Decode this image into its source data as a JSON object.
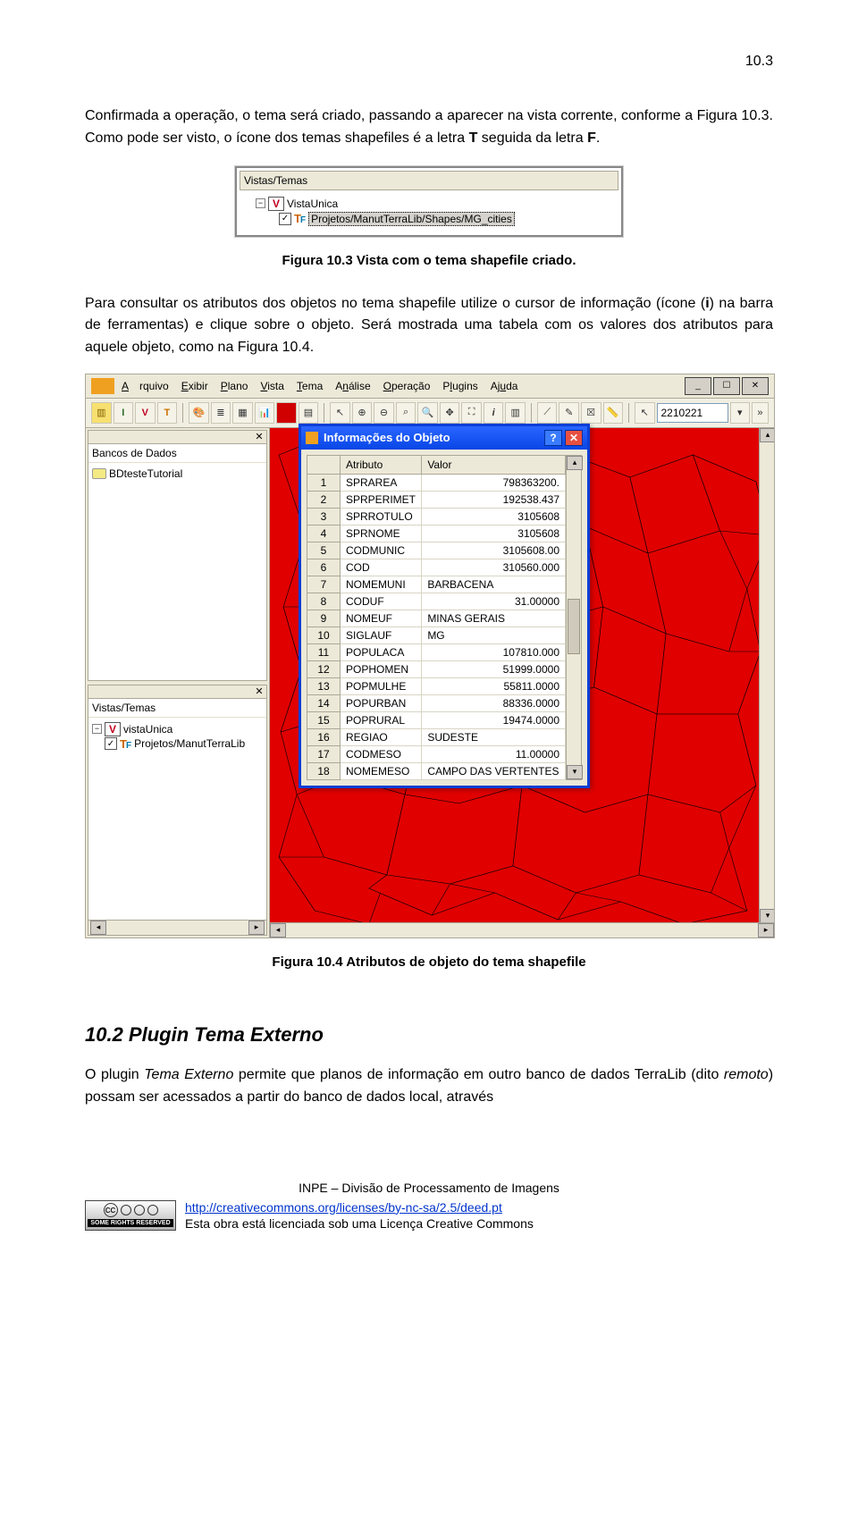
{
  "page_number": "10.3",
  "para1_a": "Confirmada a operação, o tema será criado, passando a aparecer na vista corrente, conforme a Figura 10.3. Como pode ser visto, o ícone dos temas shapefiles é a letra ",
  "para1_t": "T",
  "para1_b": " seguida da letra ",
  "para1_f": "F",
  "para1_c": ".",
  "fig103": {
    "panel_title": "Vistas/Temas",
    "view_name": "VistaUnica",
    "theme_path": "Projetos/ManutTerraLib/Shapes/MG_cities"
  },
  "caption103": "Figura 10.3 Vista com o tema shapefile criado.",
  "para2_a": "Para consultar os atributos dos objetos no tema shapefile utilize o cursor de informação (ícone (",
  "para2_i": "i",
  "para2_b": ") na barra de ferramentas) e clique sobre o objeto. Será mostrada uma tabela com os valores dos atributos para aquele objeto, como na Figura 10.4.",
  "fig104": {
    "menu": [
      "Arquivo",
      "Exibir",
      "Plano",
      "Vista",
      "Tema",
      "Análise",
      "Operação",
      "Plugins",
      "Ajuda"
    ],
    "toolbar_value": "2210221",
    "db_panel": {
      "title": "Bancos de Dados",
      "item": "BDtesteTutorial"
    },
    "vt_panel": {
      "title": "Vistas/Temas",
      "view": "vistaUnica",
      "theme": "Projetos/ManutTerraLib"
    },
    "dialog": {
      "title": "Informações do Objeto",
      "col1": "Atributo",
      "col2": "Valor",
      "rows": [
        {
          "n": "1",
          "attr": "SPRAREA",
          "val": "798363200.",
          "num": true
        },
        {
          "n": "2",
          "attr": "SPRPERIMET",
          "val": "192538.437",
          "num": true
        },
        {
          "n": "3",
          "attr": "SPRROTULO",
          "val": "3105608",
          "num": true
        },
        {
          "n": "4",
          "attr": "SPRNOME",
          "val": "3105608",
          "num": true
        },
        {
          "n": "5",
          "attr": "CODMUNIC",
          "val": "3105608.00",
          "num": true
        },
        {
          "n": "6",
          "attr": "COD",
          "val": "310560.000",
          "num": true
        },
        {
          "n": "7",
          "attr": "NOMEMUNI",
          "val": "BARBACENA",
          "num": false
        },
        {
          "n": "8",
          "attr": "CODUF",
          "val": "31.00000",
          "num": true
        },
        {
          "n": "9",
          "attr": "NOMEUF",
          "val": "MINAS GERAIS",
          "num": false
        },
        {
          "n": "10",
          "attr": "SIGLAUF",
          "val": "MG",
          "num": false
        },
        {
          "n": "11",
          "attr": "POPULACA",
          "val": "107810.000",
          "num": true
        },
        {
          "n": "12",
          "attr": "POPHOMEN",
          "val": "51999.0000",
          "num": true
        },
        {
          "n": "13",
          "attr": "POPMULHE",
          "val": "55811.0000",
          "num": true
        },
        {
          "n": "14",
          "attr": "POPURBAN",
          "val": "88336.0000",
          "num": true
        },
        {
          "n": "15",
          "attr": "POPRURAL",
          "val": "19474.0000",
          "num": true
        },
        {
          "n": "16",
          "attr": "REGIAO",
          "val": "SUDESTE",
          "num": false
        },
        {
          "n": "17",
          "attr": "CODMESO",
          "val": "11.00000",
          "num": true
        },
        {
          "n": "18",
          "attr": "NOMEMESO",
          "val": "CAMPO DAS VERTENTES",
          "num": false
        }
      ]
    }
  },
  "caption104": "Figura 10.4  Atributos de objeto do tema shapefile",
  "h2": "10.2  Plugin Tema Externo",
  "para3_a": "O plugin ",
  "para3_em": "Tema Externo",
  "para3_b": " permite que planos de informação em outro banco de dados TerraLib (dito ",
  "para3_em2": "remoto",
  "para3_c": ") possam ser acessados a partir do banco de dados local, através",
  "footer_org": "INPE – Divisão de Processamento de Imagens",
  "cc": {
    "badge_top": "CC",
    "badge_bottom": "SOME RIGHTS RESERVED",
    "url": "http://creativecommons.org/licenses/by-nc-sa/2.5/deed.pt",
    "text": "Esta obra está licenciada sob uma Licença Creative Commons"
  }
}
